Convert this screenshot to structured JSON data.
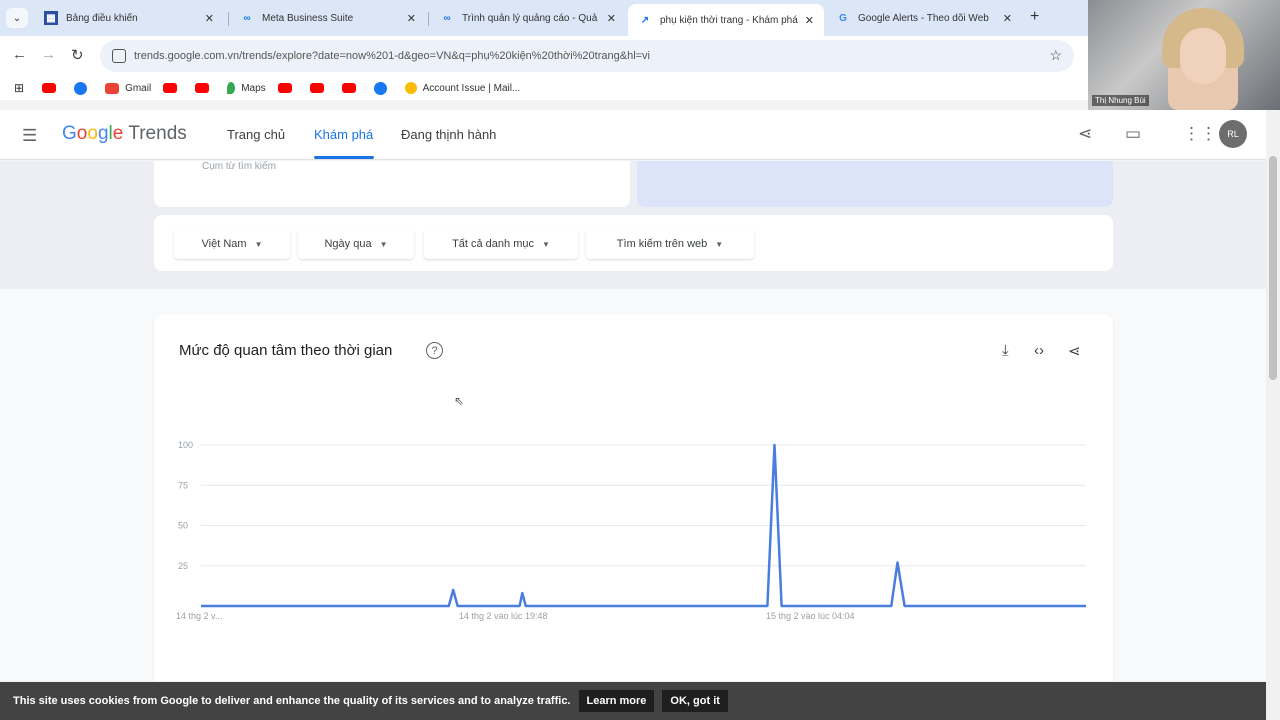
{
  "browser": {
    "tabs": [
      {
        "title": "Bảng điều khiển",
        "favicon": "dashboard-icon",
        "active": false
      },
      {
        "title": "Meta Business Suite",
        "favicon": "meta-icon",
        "active": false
      },
      {
        "title": "Trình quản lý quảng cáo - Quả",
        "favicon": "meta-icon",
        "active": false
      },
      {
        "title": "phụ kiện thời trang - Khám phá",
        "favicon": "trends-icon",
        "active": true
      },
      {
        "title": "Google Alerts - Theo dõi Web",
        "favicon": "google-icon",
        "active": false
      }
    ],
    "url": "trends.google.com.vn/trends/explore?date=now%201-d&geo=VN&q=phụ%20kiện%20thời%20trang&hl=vi",
    "bookmarks": [
      {
        "label": "",
        "icon": "youtube-icon"
      },
      {
        "label": "",
        "icon": "facebook-icon"
      },
      {
        "label": "Gmail",
        "icon": "gmail-icon"
      },
      {
        "label": "",
        "icon": "youtube-icon"
      },
      {
        "label": "",
        "icon": "youtube-icon"
      },
      {
        "label": "Maps",
        "icon": "maps-icon"
      },
      {
        "label": "",
        "icon": "youtube-icon"
      },
      {
        "label": "",
        "icon": "youtube-icon"
      },
      {
        "label": "",
        "icon": "youtube-icon"
      },
      {
        "label": "",
        "icon": "facebook-icon"
      },
      {
        "label": "Account Issue | Mail...",
        "icon": "account-icon"
      }
    ]
  },
  "webcam": {
    "name": "Thị Nhung Bùi"
  },
  "header": {
    "logo_google": "Google",
    "logo_trends": "Trends",
    "nav": [
      "Trang chủ",
      "Khám phá",
      "Đang thịnh hành"
    ],
    "avatar_text": "RL"
  },
  "search": {
    "term_label": "Cụm từ tìm kiếm"
  },
  "filters": [
    "Việt Nam",
    "Ngày qua",
    "Tất cả danh mục",
    "Tìm kiếm trên web"
  ],
  "chart_card": {
    "title": "Mức độ quan tâm theo thời gian"
  },
  "chart_data": {
    "type": "line",
    "title": "Mức độ quan tâm theo thời gian",
    "xlabel": "",
    "ylabel": "",
    "ylim": [
      0,
      100
    ],
    "yticks": [
      25,
      50,
      75,
      100
    ],
    "x_tick_labels": [
      "14 thg 2 v...",
      "14 thg 2 vào lúc 19:48",
      "15 thg 2 vào lúc 04:04"
    ],
    "series": [
      {
        "color": "#4a7de0",
        "points": [
          [
            0,
            0
          ],
          [
            0.28,
            0
          ],
          [
            0.285,
            10
          ],
          [
            0.29,
            0
          ],
          [
            0.36,
            0
          ],
          [
            0.363,
            8
          ],
          [
            0.367,
            0
          ],
          [
            0.64,
            0
          ],
          [
            0.648,
            100
          ],
          [
            0.656,
            0
          ],
          [
            0.78,
            0
          ],
          [
            0.787,
            27
          ],
          [
            0.795,
            0
          ],
          [
            1,
            0
          ]
        ]
      }
    ],
    "grid": true,
    "legend": "none"
  },
  "cookie": {
    "message": "This site uses cookies from Google to deliver and enhance the quality of its services and to analyze traffic.",
    "learn_more": "Learn more",
    "ok": "OK, got it"
  }
}
